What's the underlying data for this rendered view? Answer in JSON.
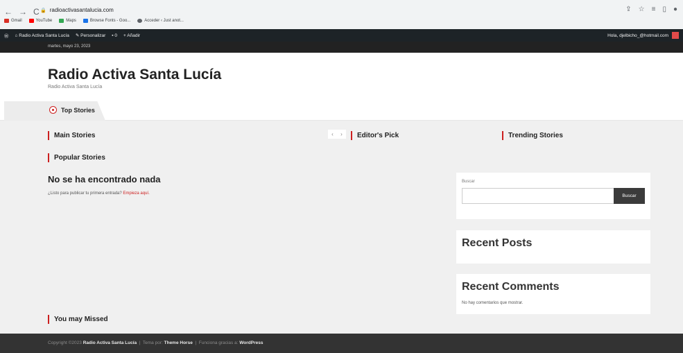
{
  "browser": {
    "url": "radioactivasantalucia.com",
    "bookmarks": [
      {
        "label": "Gmail",
        "color": "#d93025"
      },
      {
        "label": "YouTube",
        "color": "#ff0000"
      },
      {
        "label": "Maps",
        "color": "#34a853"
      },
      {
        "label": "Browse Fonts - Goo...",
        "color": "#1a73e8"
      },
      {
        "label": "Acceder ‹ Just anot...",
        "color": "#5f6368"
      }
    ]
  },
  "admin_bar": {
    "site_name": "Radio Activa Santa Lucía",
    "customize": "Personalizar",
    "comments_count": "0",
    "add_new": "Añadir",
    "greeting": "Hola, djelbicho_@hotmail.com"
  },
  "header": {
    "date": "martes, mayo 23, 2023",
    "title": "Radio Activa Santa Lucía",
    "description": "Radio Activa Santa Lucía"
  },
  "tabs": {
    "top_stories": "Top Stories"
  },
  "sections": {
    "main_stories": "Main Stories",
    "editors_pick": "Editor's Pick",
    "trending_stories": "Trending Stories",
    "popular_stories": "Popular Stories",
    "you_may_missed": "You may Missed"
  },
  "content": {
    "nothing_title": "No se ha encontrado nada",
    "nothing_text": "¿Listo para publicar tu primera entrada?",
    "nothing_link": "Empieza aquí."
  },
  "sidebar": {
    "search_label": "Buscar",
    "search_value": "",
    "search_button": "Buscar",
    "recent_posts": "Recent Posts",
    "recent_comments": "Recent Comments",
    "no_comments": "No hay comentarios que mostrar."
  },
  "footer": {
    "copyright": "Copyright ©2023",
    "site": "Radio Activa Santa Lucía",
    "theme_by": "Tema por:",
    "theme": "Theme Horse",
    "powered": "Funciona gracias a:",
    "wordpress": "WordPress"
  },
  "colors": {
    "accent": "#cc1f1f",
    "footer_bg": "#333333",
    "admin_bg": "#1d2327"
  }
}
